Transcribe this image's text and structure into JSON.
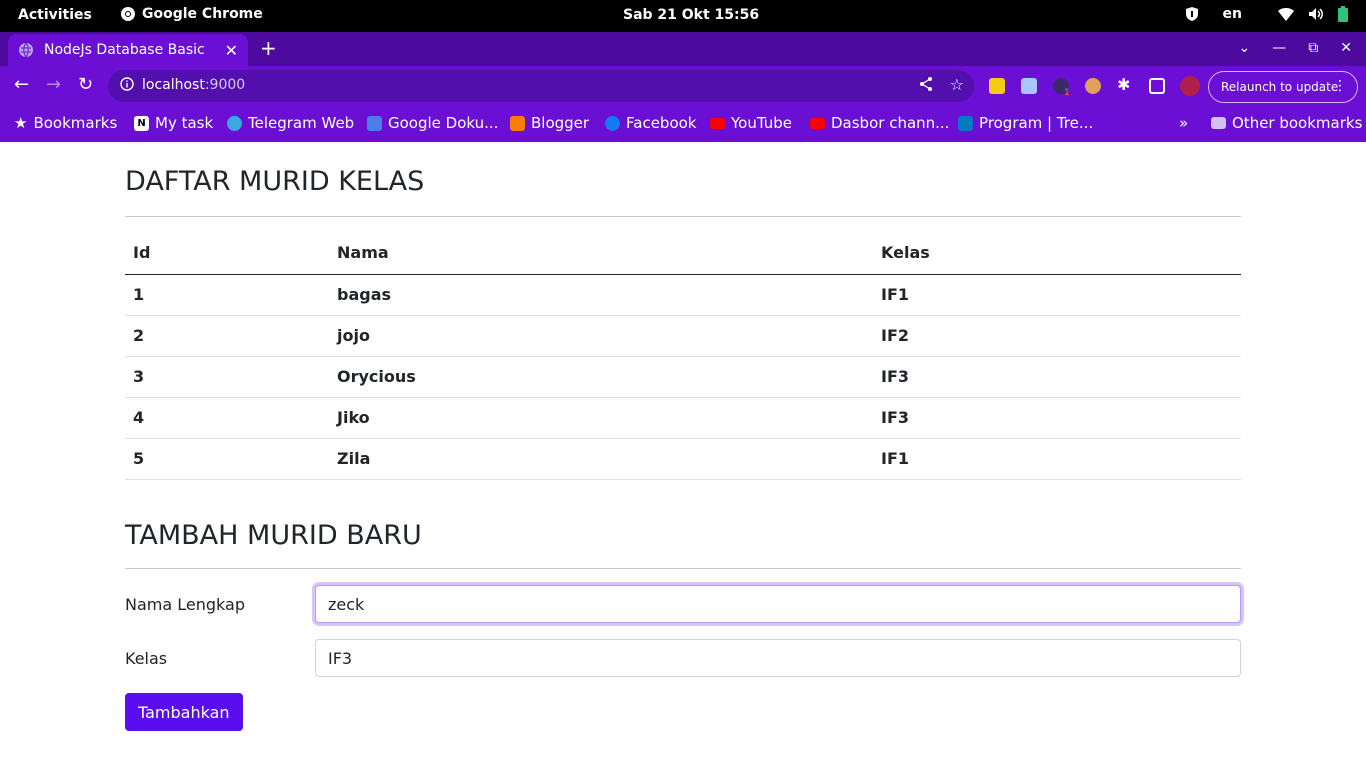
{
  "system": {
    "activities": "Activities",
    "app_name": "Google Chrome",
    "clock": "Sab 21 Okt  15:56",
    "lang": "en"
  },
  "browser": {
    "tab_title": "NodeJs Database Basic",
    "url_host": "localhost",
    "url_port": ":9000",
    "relaunch_label": "Relaunch to update",
    "ext_badge": "1"
  },
  "bookmarks": [
    {
      "label": "Bookmarks",
      "icon": "star-icon"
    },
    {
      "label": "My task",
      "icon": "notion-icon"
    },
    {
      "label": "Telegram Web",
      "icon": "telegram-icon"
    },
    {
      "label": "Google Doku...",
      "icon": "google-docs-icon"
    },
    {
      "label": "Blogger",
      "icon": "blogger-icon"
    },
    {
      "label": "Facebook",
      "icon": "facebook-icon"
    },
    {
      "label": "YouTube",
      "icon": "youtube-icon"
    },
    {
      "label": "Dasbor chann...",
      "icon": "youtube-icon"
    },
    {
      "label": "Program | Tre...",
      "icon": "trello-icon"
    },
    {
      "label": "Other bookmarks",
      "icon": "folder-icon"
    }
  ],
  "colors": {
    "accent": "#6a0fd3",
    "button": "#5a0ef0"
  },
  "page": {
    "list_title": "DAFTAR MURID KELAS",
    "table": {
      "headers": [
        "Id",
        "Nama",
        "Kelas"
      ],
      "rows": [
        [
          "1",
          "bagas",
          "IF1"
        ],
        [
          "2",
          "jojo",
          "IF2"
        ],
        [
          "3",
          "Orycious",
          "IF3"
        ],
        [
          "4",
          "Jiko",
          "IF3"
        ],
        [
          "5",
          "Zila",
          "IF1"
        ]
      ]
    },
    "form_title": "TAMBAH MURID BARU",
    "form": {
      "nama_label": "Nama Lengkap",
      "nama_value": "zeck",
      "kelas_label": "Kelas",
      "kelas_value": "IF3",
      "submit_label": "Tambahkan"
    }
  }
}
